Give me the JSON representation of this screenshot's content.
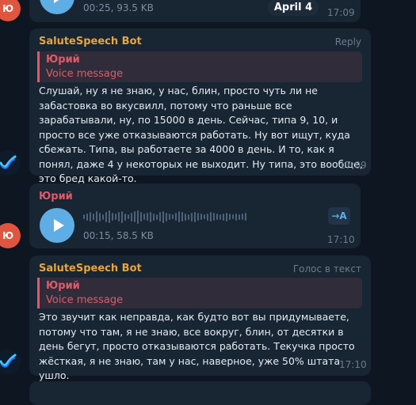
{
  "date_badge": "April 4",
  "avatar_user_initials": "Ю",
  "messages": [
    {
      "kind": "voice",
      "meta": "00:25, 93.5 KB",
      "time": "17:09"
    },
    {
      "kind": "bot_reply",
      "sender": "SaluteSpeech Bot",
      "action": "Reply",
      "quote_name": "Юрий",
      "quote_text": "Voice message",
      "text": "Слушай, ну я не знаю, у нас, блин, просто чуть ли не забастовка во вкусвилл, потому что раньше все зарабатывали, ну, по 15000 в день. Сейчас, типа 9, 10, и просто все уже отказываются работать. Ну вот ищут, куда сбежать. Типа, вы работаете за 4000 в день. И то, как я понял, даже 4 у некоторых не выходит. Ну типа, это вообще, это бред какой-то.",
      "time": "17:09"
    },
    {
      "kind": "voice",
      "sender": "Юрий",
      "meta": "00:15, 58.5 KB",
      "transcribe_label": "→A",
      "time": "17:10"
    },
    {
      "kind": "bot_reply",
      "sender": "SaluteSpeech Bot",
      "action": "Голос в текст",
      "quote_name": "Юрий",
      "quote_text": "Voice message",
      "text": "Это звучит как неправда, как будто вот вы придумываете, потому что там, я не знаю, все вокруг, блин, от десятки в день бегут, просто отказываются работать. Текучка просто жёсткая, я не знаю, там у нас, наверное, уже 50% штата ушло.",
      "time": "17:10"
    }
  ],
  "colors": {
    "background": "#0e1621",
    "bubble": "#182533",
    "bot_name": "#e8a53c",
    "user_name": "#e05a6a",
    "accent": "#5eaee5",
    "avatar_user": "#e0553f"
  },
  "icons": [
    "play-icon",
    "bot-logo-icon",
    "transcribe-icon"
  ]
}
